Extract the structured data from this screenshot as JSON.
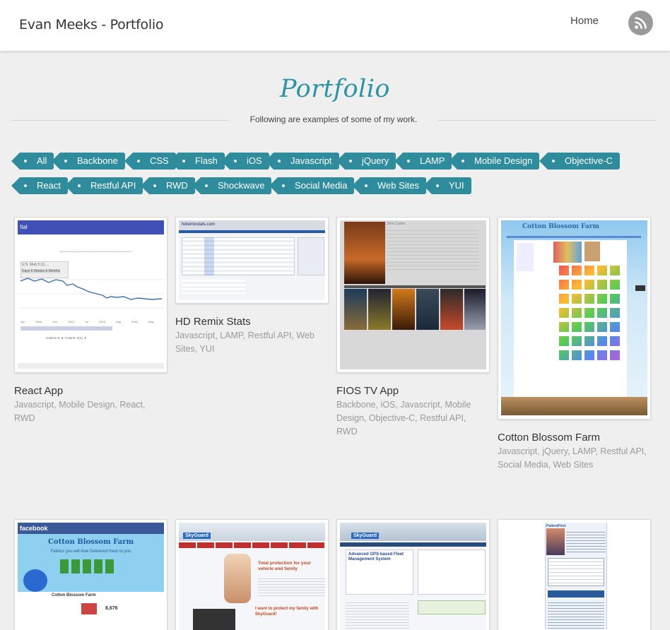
{
  "header": {
    "site_title": "Evan Meeks - Portfolio",
    "nav_home": "Home",
    "rss_icon": "rss-icon"
  },
  "page": {
    "heading": "Portfolio",
    "subtitle": "Following are examples of some of my work."
  },
  "filters": {
    "row1": [
      "All",
      "Backbone",
      "CSS",
      "Flash",
      "iOS",
      "Javascript",
      "jQuery",
      "LAMP",
      "Mobile Design",
      "Objective-C"
    ],
    "row2": [
      "React",
      "Restful API",
      "RWD",
      "Shockwave",
      "Social Media",
      "Web Sites",
      "YUI"
    ]
  },
  "items": [
    {
      "title": "React App",
      "tags": "Javascript, Mobile Design, React, RWD"
    },
    {
      "title": "HD Remix Stats",
      "tags": "Javascript, LAMP, Restful API, Web Sites, YUI"
    },
    {
      "title": "FIOS TV App",
      "tags": "Backbone, iOS, Javascript, Mobile Design, Objective-C, Restful API, RWD"
    },
    {
      "title": "Cotton Blossom Farm",
      "tags": "Javascript, jQuery, LAMP, Restful API, Social Media, Web Sites"
    },
    {
      "title": "",
      "tags": ""
    },
    {
      "title": "",
      "tags": ""
    },
    {
      "title": "",
      "tags": ""
    },
    {
      "title": "",
      "tags": ""
    }
  ],
  "thumb_text": {
    "react": {
      "brand": "Ital",
      "card": "U.S. Mutt 3 (1) ...",
      "range": "Days  6 Weeks  6 Months",
      "x_ticks": [
        "Apr 2016",
        "Jun 2016",
        "Jul 2016",
        "Aug 2016",
        "May 2016"
      ],
      "legend": "Column 0, ●, Column 2(1), ●"
    },
    "hdremix": {
      "brand": "hdremixstats.com"
    },
    "fios": {
      "brand": "FLEXVIEW",
      "movie_title": "John Carter",
      "posters": [
        "JOHN CARTER",
        "IN TIME",
        "JOHN CARTER",
        "BATTLESHIP",
        "HAYWIRE",
        "SNOW WHITE"
      ]
    },
    "cotton": {
      "brand": "Cotton Blossom Farm"
    },
    "facebook": {
      "brand": "facebook",
      "headline": "Cotton Blossom Farm",
      "tagline": "Fabrics you will love Delivered fresh to you",
      "page_name": "Cotton Blossom Farm",
      "likes": "8,676"
    },
    "skyguard1": {
      "brand": "SkyGuard",
      "headline": "Total protection for your vehicle and family",
      "sub": "I want to protect my family with SkyGuard!"
    },
    "skyguard2": {
      "brand": "SkyGuard",
      "headline": "Advanced GPS-based Fleet Management System"
    },
    "doc": {
      "brand": "PatientFirst"
    }
  },
  "colors": {
    "accent": "#2e8c9c",
    "heading": "#2b93a6",
    "background": "#efefef",
    "muted": "#9a9a9a"
  }
}
